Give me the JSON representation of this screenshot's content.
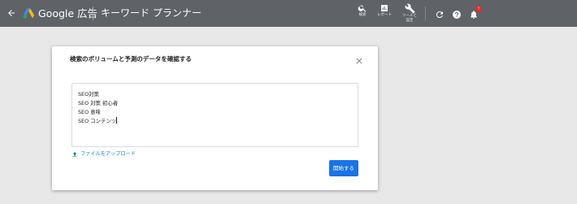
{
  "header": {
    "back_icon": "arrow-back-icon",
    "brand_name": "Google 広告",
    "app_title": "キーワード プランナー",
    "tools": [
      {
        "icon": "search-icon",
        "label": "検索"
      },
      {
        "icon": "report-icon",
        "label": "レポート"
      },
      {
        "icon": "wrench-icon",
        "label_line1": "ツールと",
        "label_line2": "設定"
      }
    ],
    "refresh_icon": "refresh-icon",
    "help_icon": "help-icon",
    "notifications_icon": "bell-icon",
    "notification_badge": "!",
    "background_color": "#5f6368"
  },
  "dialog": {
    "title": "検索のボリュームと予測のデータを確認する",
    "close_icon": "close-icon",
    "keywords": [
      "SEO対策",
      "SEO 対策 初心者",
      "SEO 意味",
      "SEO コンテンツ"
    ],
    "upload_icon": "upload-icon",
    "upload_label": "ファイルをアップロード",
    "start_button": "開始する",
    "accent_color": "#1a73e8"
  }
}
